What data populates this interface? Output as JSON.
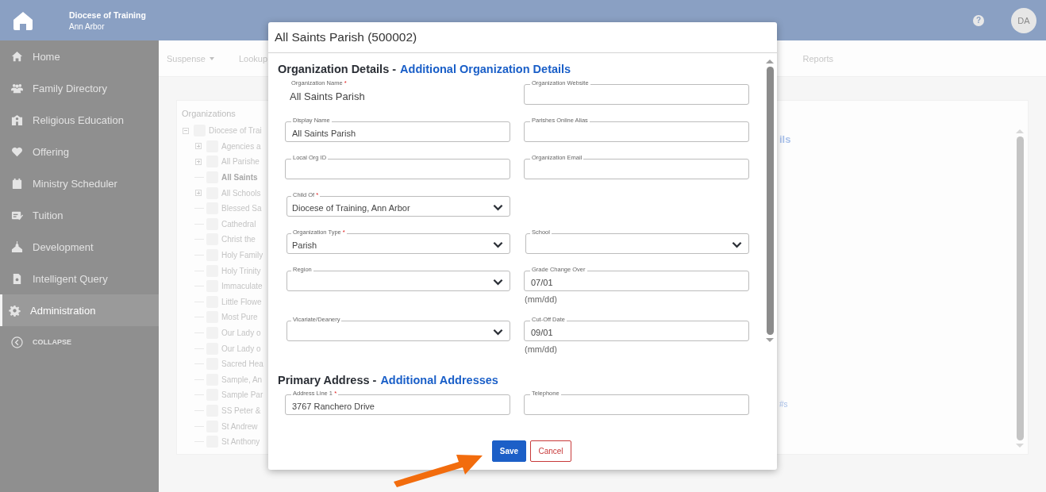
{
  "header": {
    "org_name": "Diocese of Training",
    "org_city": "Ann Arbor",
    "help": "?",
    "avatar": "DA"
  },
  "sidebar": {
    "items": [
      {
        "label": "Home",
        "selected": false
      },
      {
        "label": "Family Directory",
        "selected": false
      },
      {
        "label": "Religious Education",
        "selected": false
      },
      {
        "label": "Offering",
        "selected": false
      },
      {
        "label": "Ministry Scheduler",
        "selected": false
      },
      {
        "label": "Tuition",
        "selected": false
      },
      {
        "label": "Development",
        "selected": false
      },
      {
        "label": "Intelligent Query",
        "selected": false
      },
      {
        "label": "Administration",
        "selected": true
      }
    ],
    "collapse": "COLLAPSE"
  },
  "nav": {
    "left": [
      {
        "label": "Suspense",
        "dropdown": true
      },
      {
        "label": "Lookup",
        "dropdown": false
      }
    ],
    "right": [
      {
        "label": "Reports",
        "dropdown": false
      }
    ]
  },
  "organizations": {
    "title": "Organizations",
    "tree": [
      {
        "label": "Diocese of Trai",
        "kind": "group",
        "expanded": true,
        "selected": false,
        "checked": false,
        "children": [
          {
            "label": "Agencies a",
            "kind": "group",
            "expanded": false,
            "selected": false,
            "checked": false
          },
          {
            "label": "All Parishe",
            "kind": "group",
            "expanded": false,
            "selected": false,
            "checked": false
          },
          {
            "label": "All Saints",
            "kind": "leaf",
            "selected": true,
            "checked": false
          },
          {
            "label": "All Schools",
            "kind": "group",
            "expanded": false,
            "selected": false,
            "checked": false
          },
          {
            "label": "Blessed Sa",
            "kind": "leaf",
            "selected": false,
            "checked": false
          },
          {
            "label": "Cathedral",
            "kind": "leaf",
            "selected": false,
            "checked": false
          },
          {
            "label": "Christ the",
            "kind": "leaf",
            "selected": false,
            "checked": false
          },
          {
            "label": "Holy Family",
            "kind": "leaf",
            "selected": false,
            "checked": false
          },
          {
            "label": "Holy Trinity",
            "kind": "leaf",
            "selected": false,
            "checked": false
          },
          {
            "label": "Immaculate",
            "kind": "leaf",
            "selected": false,
            "checked": false
          },
          {
            "label": "Little Flowe",
            "kind": "leaf",
            "selected": false,
            "checked": false
          },
          {
            "label": "Most Pure",
            "kind": "leaf",
            "selected": false,
            "checked": false
          },
          {
            "label": "Our Lady o",
            "kind": "leaf",
            "selected": false,
            "checked": false
          },
          {
            "label": "Our Lady o",
            "kind": "leaf",
            "selected": false,
            "checked": false
          },
          {
            "label": "Sacred Hea",
            "kind": "leaf",
            "selected": false,
            "checked": false
          },
          {
            "label": "Sample, An",
            "kind": "leaf",
            "selected": false,
            "checked": false
          },
          {
            "label": "Sample Par",
            "kind": "leaf",
            "selected": false,
            "checked": false
          },
          {
            "label": "SS Peter &",
            "kind": "leaf",
            "selected": false,
            "checked": false
          },
          {
            "label": "St Andrew",
            "kind": "leaf",
            "selected": false,
            "checked": false
          },
          {
            "label": "St Anthony",
            "kind": "leaf",
            "selected": false,
            "checked": false
          }
        ]
      }
    ],
    "fragments": [
      "ils",
      "#s"
    ]
  },
  "modal": {
    "title": "All Saints Parish (500002)",
    "sections": [
      {
        "title": "Organization Details -",
        "link": "Additional Organization Details",
        "rows": [
          [
            {
              "kind": "static",
              "label": "Organization Name",
              "required": "*",
              "value": "All Saints Parish"
            },
            {
              "kind": "text",
              "label": "Organization Website"
            }
          ],
          [
            {
              "kind": "text",
              "label": "Display Name",
              "value": "All Saints Parish"
            },
            {
              "kind": "text",
              "label": "Parishes Online Alias"
            }
          ],
          [
            {
              "kind": "text",
              "label": "Local Org ID"
            },
            {
              "kind": "text",
              "label": "Organization Email"
            }
          ],
          [
            {
              "kind": "select",
              "label": "Child Of",
              "required": "*",
              "value": "Diocese of Training, Ann Arbor"
            }
          ],
          [
            {
              "kind": "select",
              "label": "Organization Type",
              "required": "*",
              "value": "Parish"
            },
            {
              "kind": "select",
              "label": "School"
            }
          ],
          [
            {
              "kind": "select",
              "label": "Region"
            },
            {
              "kind": "text",
              "label": "Grade Change Over",
              "value": "07/01",
              "hint": "(mm/dd)"
            }
          ],
          [
            {
              "kind": "select",
              "label": "Vicariate/Deanery"
            },
            {
              "kind": "text",
              "label": "Cut-Off Date",
              "value": "09/01",
              "hint": "(mm/dd)"
            }
          ]
        ]
      },
      {
        "title": "Primary Address -",
        "link": "Additional Addresses",
        "rows": [
          [
            {
              "kind": "text",
              "label": "Address Line 1",
              "required": "*",
              "value": "3767 Ranchero Drive"
            },
            {
              "kind": "text",
              "label": "Telephone"
            }
          ]
        ]
      }
    ],
    "buttons": [
      {
        "label": "Save",
        "kind": "primary"
      },
      {
        "label": "Cancel",
        "kind": "cancel"
      }
    ]
  }
}
